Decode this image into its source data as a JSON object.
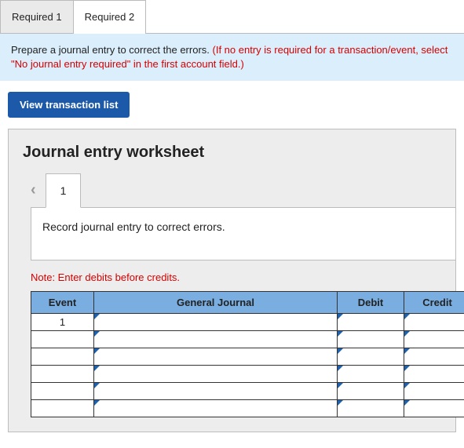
{
  "tabs": {
    "tab1": "Required 1",
    "tab2": "Required 2"
  },
  "instructions": {
    "black": "Prepare a journal entry to correct the errors. ",
    "red": "(If no entry is required for a transaction/event, select \"No journal entry required\" in the first account field.)"
  },
  "buttons": {
    "view_list": "View transaction list"
  },
  "worksheet": {
    "title": "Journal entry worksheet",
    "subtab": "1",
    "description": "Record journal entry to correct errors.",
    "note": "Note: Enter debits before credits.",
    "headers": {
      "event": "Event",
      "gj": "General Journal",
      "debit": "Debit",
      "credit": "Credit"
    },
    "rows": [
      {
        "event": "1",
        "gj": "",
        "debit": "",
        "credit": ""
      },
      {
        "event": "",
        "gj": "",
        "debit": "",
        "credit": ""
      },
      {
        "event": "",
        "gj": "",
        "debit": "",
        "credit": ""
      },
      {
        "event": "",
        "gj": "",
        "debit": "",
        "credit": ""
      },
      {
        "event": "",
        "gj": "",
        "debit": "",
        "credit": ""
      },
      {
        "event": "",
        "gj": "",
        "debit": "",
        "credit": ""
      }
    ]
  }
}
